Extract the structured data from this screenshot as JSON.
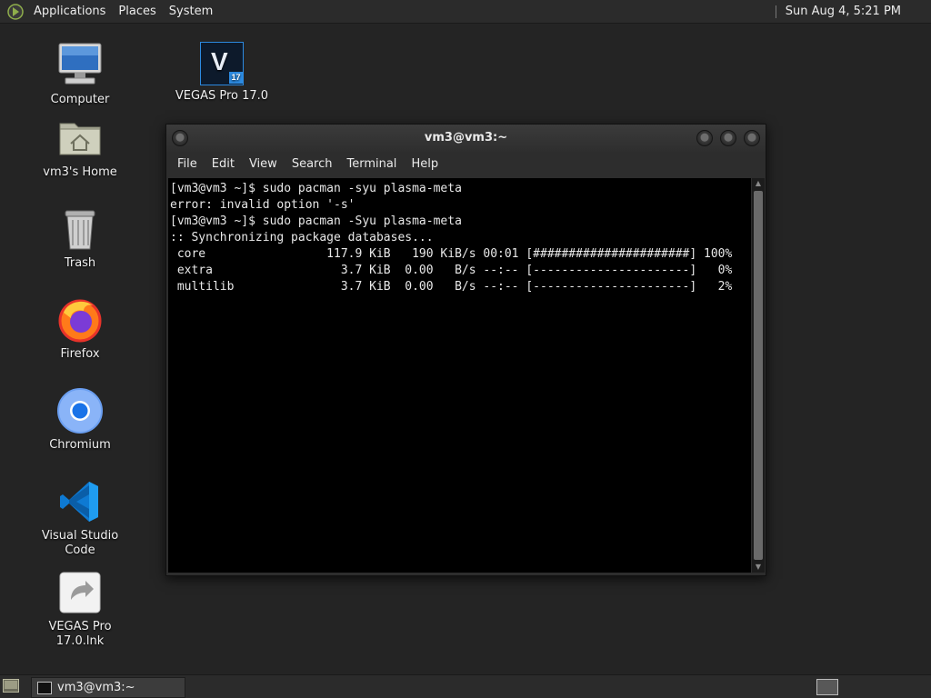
{
  "top_panel": {
    "menu": [
      "Applications",
      "Places",
      "System"
    ],
    "clock": "Sun Aug  4,  5:21 PM"
  },
  "desktop": {
    "icons": [
      {
        "label": "Computer",
        "icon": "computer-icon"
      },
      {
        "label": "vm3's Home",
        "icon": "home-folder-icon"
      },
      {
        "label": "Trash",
        "icon": "trash-icon"
      },
      {
        "label": "Firefox",
        "icon": "firefox-icon"
      },
      {
        "label": "Chromium",
        "icon": "chromium-icon"
      },
      {
        "label": "Visual Studio Code",
        "icon": "vscode-icon"
      },
      {
        "label": "VEGAS Pro 17.0.lnk",
        "icon": "shortcut-icon"
      },
      {
        "label": "VEGAS Pro 17.0",
        "icon": "vegas-icon"
      }
    ],
    "vegas_badge": "17",
    "vegas_letter": "V"
  },
  "terminal": {
    "title": "vm3@vm3:~",
    "menu": [
      "File",
      "Edit",
      "View",
      "Search",
      "Terminal",
      "Help"
    ],
    "lines": [
      "[vm3@vm3 ~]$ sudo pacman -syu plasma-meta",
      "error: invalid option '-s'",
      "[vm3@vm3 ~]$ sudo pacman -Syu plasma-meta",
      ":: Synchronizing package databases...",
      " core                 117.9 KiB   190 KiB/s 00:01 [######################] 100%",
      " extra                  3.7 KiB  0.00   B/s --:-- [----------------------]   0%",
      " multilib               3.7 KiB  0.00   B/s --:-- [----------------------]   2%"
    ]
  },
  "taskbar": {
    "task_label": "vm3@vm3:~"
  }
}
